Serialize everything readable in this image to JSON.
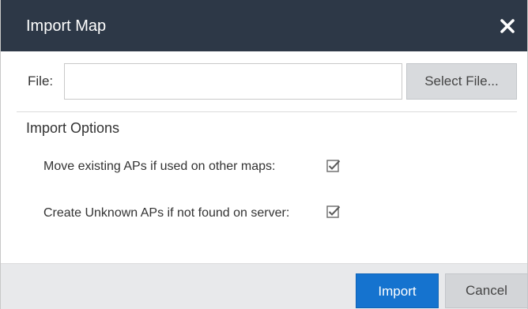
{
  "dialog": {
    "title": "Import Map",
    "close_icon": "close-icon"
  },
  "file": {
    "label": "File:",
    "value": "",
    "placeholder": "",
    "select_button": "Select File..."
  },
  "import_options": {
    "title": "Import Options",
    "options": [
      {
        "label": "Move existing APs if used on other maps:",
        "checked": true
      },
      {
        "label": "Create Unknown APs if not found on server:",
        "checked": true
      }
    ]
  },
  "footer": {
    "import_label": "Import",
    "cancel_label": "Cancel"
  },
  "colors": {
    "titlebar": "#2d3847",
    "primary_button": "#1573cf",
    "footer_bg": "#e8e9eb"
  }
}
